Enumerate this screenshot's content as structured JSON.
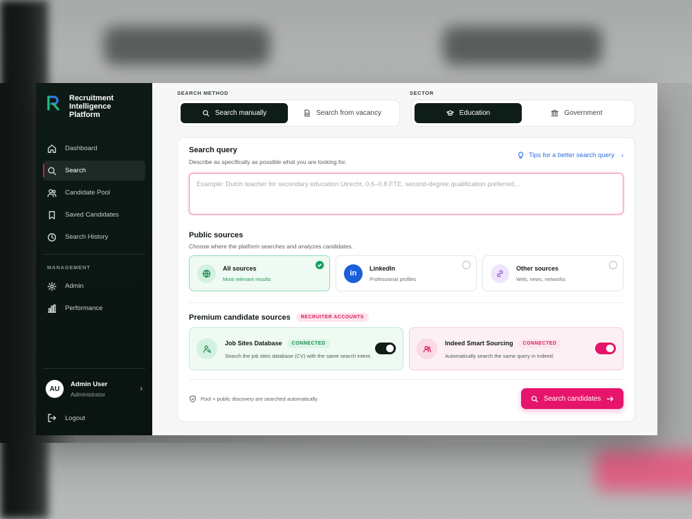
{
  "app": {
    "brand_line1": "Recruitment",
    "brand_line2": "Intelligence Platform"
  },
  "sidebar": {
    "items": [
      {
        "label": "Dashboard",
        "icon": "home-icon"
      },
      {
        "label": "Search",
        "icon": "search-icon",
        "active": true
      },
      {
        "label": "Candidate Pool",
        "icon": "users-icon"
      },
      {
        "label": "Saved Candidates",
        "icon": "bookmark-icon"
      },
      {
        "label": "Search History",
        "icon": "clock-icon"
      }
    ],
    "management_label": "MANAGEMENT",
    "management_items": [
      {
        "label": "Admin",
        "icon": "gear-icon"
      },
      {
        "label": "Performance",
        "icon": "bar-chart-icon"
      }
    ],
    "user": {
      "initials": "AU",
      "name": "Admin User",
      "role": "Administrator"
    },
    "logout_label": "Logout"
  },
  "search_method": {
    "label": "SEARCH METHOD",
    "options": [
      "Search manually",
      "Search from vacancy"
    ],
    "selected": "Search manually"
  },
  "sector": {
    "label": "SECTOR",
    "options": [
      "Education",
      "Government"
    ],
    "selected": "Education"
  },
  "query": {
    "title": "Search query",
    "subtitle": "Describe as specifically as possible what you are looking for.",
    "tips_label": "Tips for a better search query",
    "placeholder": "Example: Dutch teacher for secondary education Utrecht, 0.6–0.8 FTE, second-degree qualification preferred..."
  },
  "public_sources": {
    "title": "Public sources",
    "subtitle": "Choose where the platform searches and analyzes candidates.",
    "options": [
      {
        "title": "All sources",
        "sub": "Most relevant results",
        "selected": true
      },
      {
        "title": "LinkedIn",
        "sub": "Professional profiles",
        "selected": false
      },
      {
        "title": "Other sources",
        "sub": "Web, news, networks",
        "selected": false
      }
    ]
  },
  "premium": {
    "title": "Premium candidate sources",
    "badge": "RECRUITER ACCOUNTS",
    "sources": [
      {
        "title": "Job Sites Database",
        "status": "CONNECTED",
        "desc": "Search the job sites database (CV) with the same search intent.",
        "enabled": true
      },
      {
        "title": "Indeed Smart Sourcing",
        "status": "CONNECTED",
        "desc": "Automatically search the same query in Indeed.",
        "enabled": true
      }
    ]
  },
  "footer": {
    "note": "Pool + public discovery are searched automatically.",
    "cta_label": "Search candidates"
  },
  "colors": {
    "accent": "#e6146a",
    "sidebar_bg": "#0d1a16",
    "success": "#14a05a",
    "link": "#2c6fd6"
  }
}
